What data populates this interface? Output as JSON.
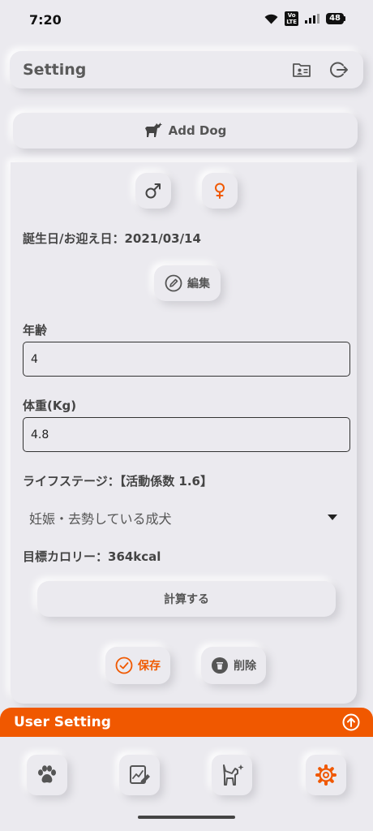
{
  "status_bar": {
    "time": "7:20",
    "volte_top": "Vo",
    "volte_bottom": "LTE",
    "battery": "48"
  },
  "header": {
    "title": "Setting"
  },
  "add_dog": {
    "label": "Add Dog"
  },
  "form": {
    "birthday": "誕生日/お迎え日：2021/03/14",
    "edit_label": "編集",
    "age_label": "年齢",
    "age_value": "4",
    "weight_label": "体重(Kg)",
    "weight_value": "4.8",
    "life_stage_label": "ライフステージ：【活動係数 1.6】",
    "life_stage_value": "妊娠・去勢している成犬",
    "target_calorie": "目標カロリー：364kcal",
    "calc_label": "計算する",
    "save_label": "保存",
    "delete_label": "削除"
  },
  "user_setting": {
    "title": "User Setting"
  },
  "colors": {
    "accent": "#f05800",
    "background": "#ebeaef",
    "text": "#444444"
  },
  "icons": {
    "header": [
      "folder-profile-icon",
      "logout-icon"
    ],
    "tabs": [
      "paw-icon",
      "chart-edit-icon",
      "dog-sparkle-icon",
      "gear-icon"
    ]
  }
}
